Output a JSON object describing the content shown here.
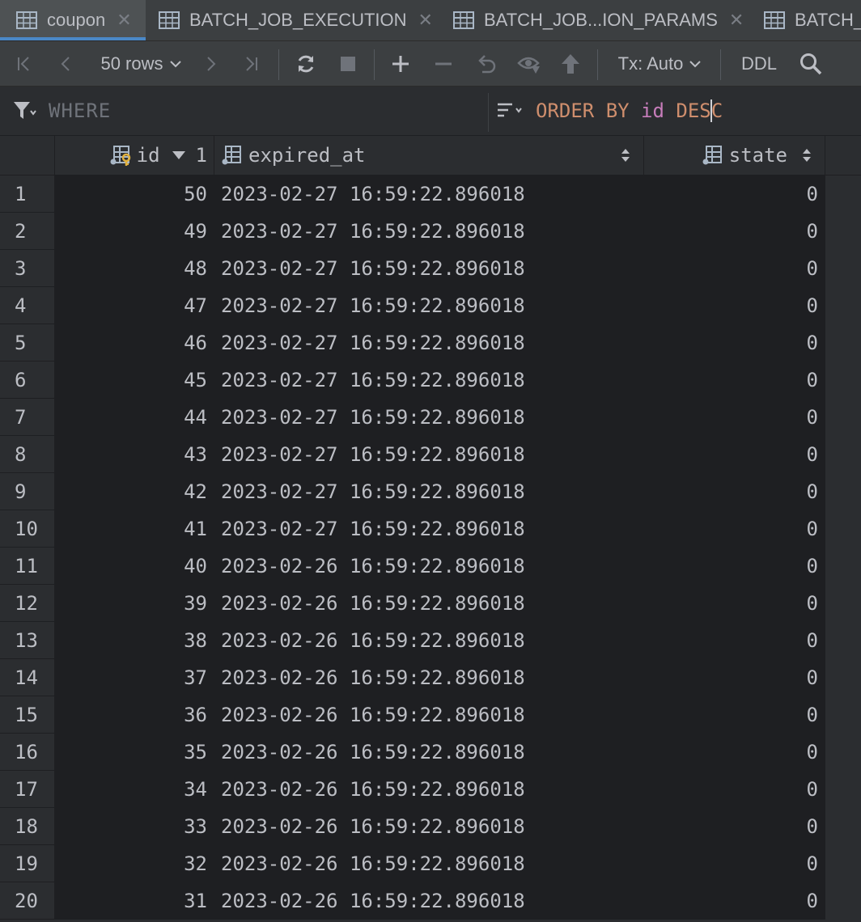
{
  "tabs": [
    {
      "label": "coupon",
      "active": true
    },
    {
      "label": "BATCH_JOB_EXECUTION",
      "active": false
    },
    {
      "label": "BATCH_JOB...ION_PARAMS",
      "active": false
    },
    {
      "label": "BATCH_...",
      "active": false
    }
  ],
  "toolbar": {
    "rows_label": "50 rows",
    "tx_label": "Tx: Auto",
    "ddl_label": "DDL"
  },
  "filter": {
    "where_placeholder": "WHERE",
    "order_kw": "ORDER BY",
    "order_col": "id",
    "order_dir_before_caret": "DES",
    "order_dir_after_caret": "C"
  },
  "columns": {
    "id": "id",
    "id_sort_order": "1",
    "expired_at": "expired_at",
    "state": "state"
  },
  "rows": [
    {
      "n": "1",
      "id": "50",
      "expired_at": "2023-02-27 16:59:22.896018",
      "state": "0"
    },
    {
      "n": "2",
      "id": "49",
      "expired_at": "2023-02-27 16:59:22.896018",
      "state": "0"
    },
    {
      "n": "3",
      "id": "48",
      "expired_at": "2023-02-27 16:59:22.896018",
      "state": "0"
    },
    {
      "n": "4",
      "id": "47",
      "expired_at": "2023-02-27 16:59:22.896018",
      "state": "0"
    },
    {
      "n": "5",
      "id": "46",
      "expired_at": "2023-02-27 16:59:22.896018",
      "state": "0"
    },
    {
      "n": "6",
      "id": "45",
      "expired_at": "2023-02-27 16:59:22.896018",
      "state": "0"
    },
    {
      "n": "7",
      "id": "44",
      "expired_at": "2023-02-27 16:59:22.896018",
      "state": "0"
    },
    {
      "n": "8",
      "id": "43",
      "expired_at": "2023-02-27 16:59:22.896018",
      "state": "0"
    },
    {
      "n": "9",
      "id": "42",
      "expired_at": "2023-02-27 16:59:22.896018",
      "state": "0"
    },
    {
      "n": "10",
      "id": "41",
      "expired_at": "2023-02-27 16:59:22.896018",
      "state": "0"
    },
    {
      "n": "11",
      "id": "40",
      "expired_at": "2023-02-26 16:59:22.896018",
      "state": "0"
    },
    {
      "n": "12",
      "id": "39",
      "expired_at": "2023-02-26 16:59:22.896018",
      "state": "0"
    },
    {
      "n": "13",
      "id": "38",
      "expired_at": "2023-02-26 16:59:22.896018",
      "state": "0"
    },
    {
      "n": "14",
      "id": "37",
      "expired_at": "2023-02-26 16:59:22.896018",
      "state": "0"
    },
    {
      "n": "15",
      "id": "36",
      "expired_at": "2023-02-26 16:59:22.896018",
      "state": "0"
    },
    {
      "n": "16",
      "id": "35",
      "expired_at": "2023-02-26 16:59:22.896018",
      "state": "0"
    },
    {
      "n": "17",
      "id": "34",
      "expired_at": "2023-02-26 16:59:22.896018",
      "state": "0"
    },
    {
      "n": "18",
      "id": "33",
      "expired_at": "2023-02-26 16:59:22.896018",
      "state": "0"
    },
    {
      "n": "19",
      "id": "32",
      "expired_at": "2023-02-26 16:59:22.896018",
      "state": "0"
    },
    {
      "n": "20",
      "id": "31",
      "expired_at": "2023-02-26 16:59:22.896018",
      "state": "0"
    }
  ],
  "colors": {
    "accent": "#4a88c7",
    "keyword": "#cf8e6d",
    "identifier": "#c77dbb"
  }
}
